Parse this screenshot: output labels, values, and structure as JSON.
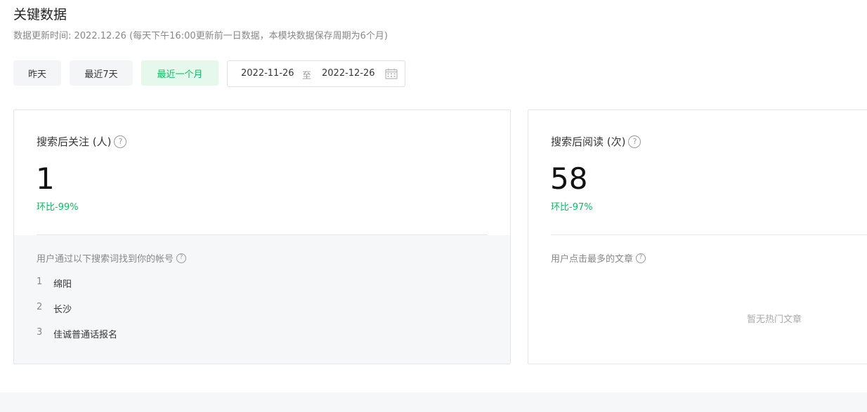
{
  "page": {
    "title": "关键数据",
    "update_note": "数据更新时间: 2022.12.26 (每天下午16:00更新前一日数据，本模块数据保存周期为6个月)"
  },
  "range_buttons": [
    {
      "label": "昨天",
      "active": false
    },
    {
      "label": "最近7天",
      "active": false
    },
    {
      "label": "最近一个月",
      "active": true
    }
  ],
  "date_range": {
    "start": "2022-11-26",
    "separator": "至",
    "end": "2022-12-26",
    "icon": "calendar-icon"
  },
  "cards": {
    "follow": {
      "title": "搜索后关注 (人)",
      "value": "1",
      "delta": "环比-99%",
      "sub_title": "用户通过以下搜索词找到你的帐号",
      "keywords": [
        {
          "rank": "1",
          "word": "绵阳"
        },
        {
          "rank": "2",
          "word": "长沙"
        },
        {
          "rank": "3",
          "word": "佳诚普通话报名"
        }
      ]
    },
    "read": {
      "title": "搜索后阅读 (次)",
      "value": "58",
      "delta": "环比-97%",
      "sub_title": "用户点击最多的文章",
      "empty": "暂无热门文章"
    }
  },
  "help_glyph": "?",
  "colors": {
    "accent": "#07c160",
    "active_bg": "#e6f7ec",
    "button_bg": "#f4f5f7",
    "panel_bg": "#f6f7f9"
  }
}
